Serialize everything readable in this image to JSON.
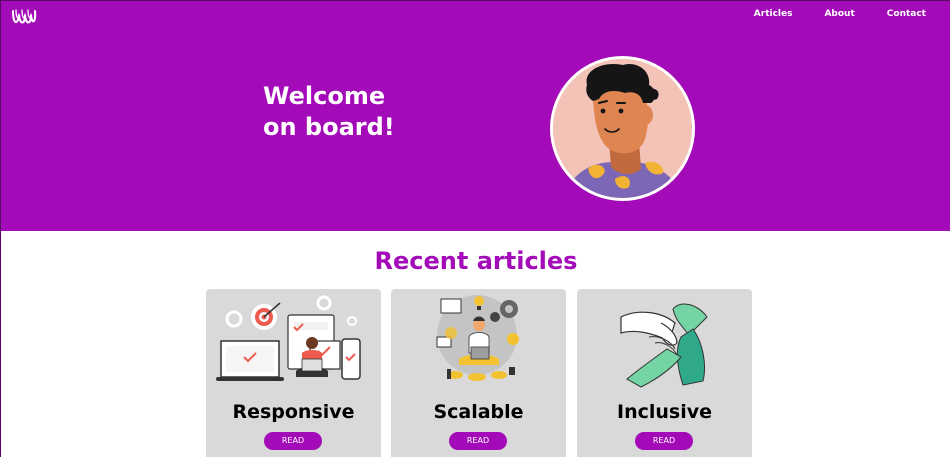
{
  "nav": {
    "items": [
      "Articles",
      "About",
      "Contact"
    ]
  },
  "hero": {
    "title": "Welcome\non board!"
  },
  "articles": {
    "heading": "Recent articles",
    "cards": [
      {
        "title": "Responsive",
        "button": "READ"
      },
      {
        "title": "Scalable",
        "button": "READ"
      },
      {
        "title": "Inclusive",
        "button": "READ"
      }
    ]
  },
  "colors": {
    "brand": "#a30ab8",
    "card_bg": "#d9d9d9",
    "text": "#000000"
  },
  "icons": [
    "logo-icon",
    "avatar-illustration",
    "responsive-illustration",
    "scalable-illustration",
    "inclusive-illustration"
  ]
}
